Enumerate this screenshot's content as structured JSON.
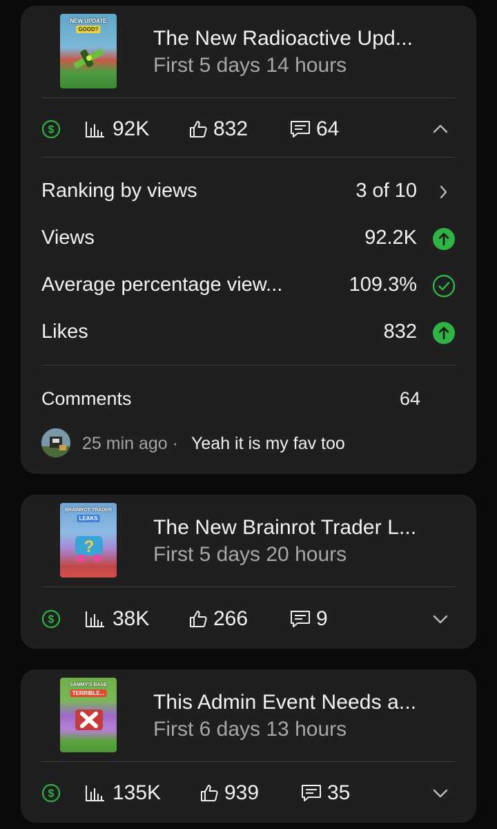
{
  "accent_green": "#2fb344",
  "videos": [
    {
      "title": "The New Radioactive Upd...",
      "subtitle": "First 5 days 14 hours",
      "thumbnail_caption": "NEW UPDATE",
      "thumbnail_tag": "GOOD?",
      "views": "92K",
      "likes": "832",
      "comments": "64",
      "expanded": true,
      "chevron_icon": "chevron-up-icon"
    },
    {
      "title": "The New Brainrot Trader L...",
      "subtitle": "First 5 days 20 hours",
      "thumbnail_caption": "BRAINROT TRADER",
      "thumbnail_tag": "LEAKS",
      "views": "38K",
      "likes": "266",
      "comments": "9",
      "expanded": false,
      "chevron_icon": "chevron-down-icon"
    },
    {
      "title": "This Admin Event Needs a...",
      "subtitle": "First 6 days 13 hours",
      "thumbnail_caption": "SAMMY'S BASE",
      "thumbnail_tag": "TERRIBLE...",
      "views": "135K",
      "likes": "939",
      "comments": "35",
      "expanded": false,
      "chevron_icon": "chevron-down-icon"
    }
  ],
  "details": {
    "ranking_label": "Ranking by views",
    "ranking_value": "3 of 10",
    "views_label": "Views",
    "views_value": "92.2K",
    "avg_label": "Average percentage view...",
    "avg_value": "109.3%",
    "likes_label": "Likes",
    "likes_value": "832",
    "comments_label": "Comments",
    "comments_value": "64"
  },
  "latest_comment": {
    "time": "25 min ago ·",
    "text": "Yeah it is my fav too"
  }
}
